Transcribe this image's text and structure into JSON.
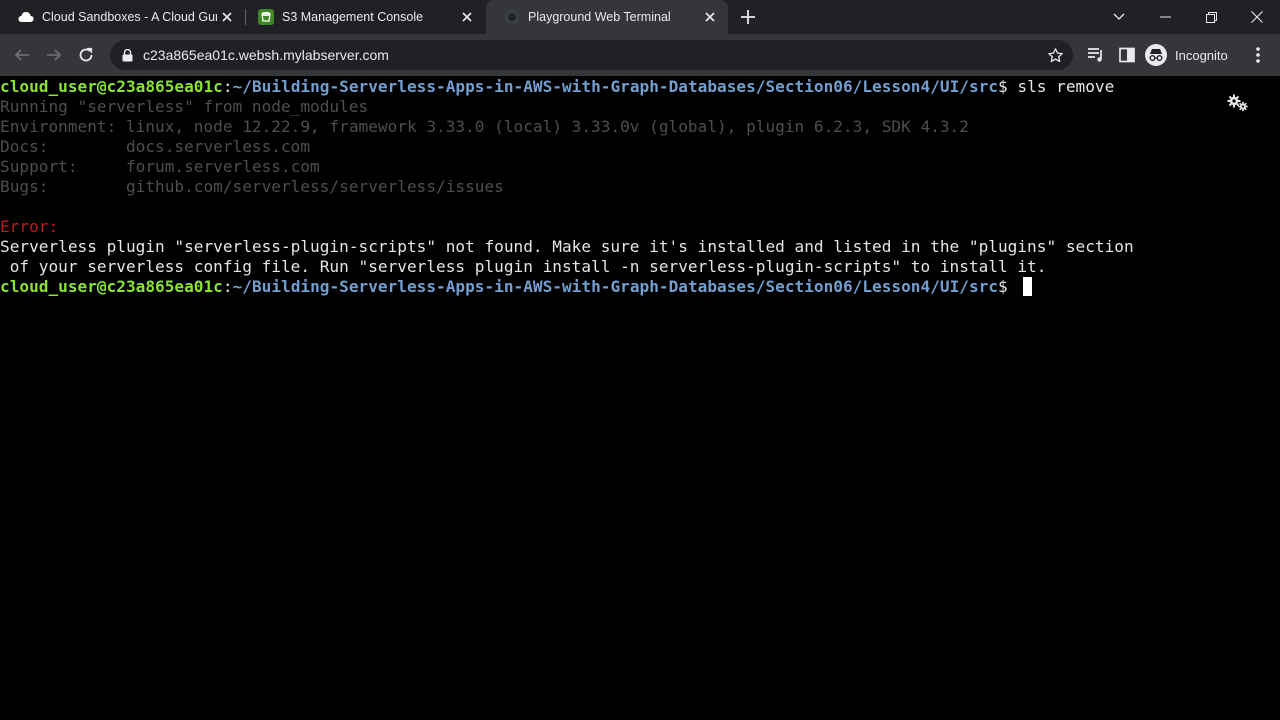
{
  "browser": {
    "tabs": [
      {
        "title": "Cloud Sandboxes - A Cloud Guru",
        "favicon": "cloud-icon"
      },
      {
        "title": "S3 Management Console",
        "favicon": "aws-s3-icon"
      },
      {
        "title": "Playground Web Terminal",
        "favicon": "terminal-globe-icon",
        "active": true
      }
    ],
    "address_bar": {
      "url": "c23a865ea01c.websh.mylabserver.com"
    },
    "profile_label": "Incognito"
  },
  "terminal": {
    "lines": {
      "l1": {
        "user": "cloud_user@c23a865ea01c",
        "sep": ":",
        "path": "~/Building-Serverless-Apps-in-AWS-with-Graph-Databases/Section06/Lesson4/UI/src",
        "dollar": "$ ",
        "cmd": "sls remove"
      },
      "l2": "Running \"serverless\" from node_modules",
      "l3": "Environment: linux, node 12.22.9, framework 3.33.0 (local) 3.33.0v (global), plugin 6.2.3, SDK 4.3.2",
      "l4": "Docs:        docs.serverless.com",
      "l5": "Support:     forum.serverless.com",
      "l6": "Bugs:        github.com/serverless/serverless/issues",
      "l8": "Error:",
      "l9": "Serverless plugin \"serverless-plugin-scripts\" not found. Make sure it's installed and listed in the \"plugins\" section",
      "l10": " of your serverless config file. Run \"serverless plugin install -n serverless-plugin-scripts\" to install it.",
      "l11": {
        "user": "cloud_user@c23a865ea01c",
        "sep": ":",
        "path": "~/Building-Serverless-Apps-in-AWS-with-Graph-Databases/Section06/Lesson4/UI/src",
        "dollar": "$ "
      }
    }
  },
  "colors": {
    "tab_strip": "#202124",
    "toolbar": "#35363a",
    "prompt_user": "#8ae234",
    "prompt_path": "#729fcf",
    "error": "#c4161c",
    "dim_text": "#4e4e4e"
  }
}
